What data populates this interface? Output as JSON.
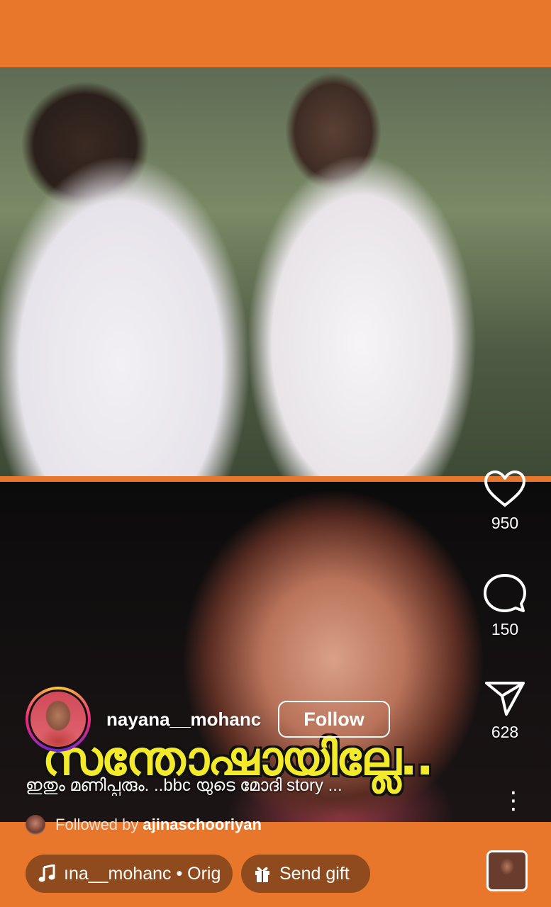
{
  "actions": {
    "likes": "950",
    "comments": "150",
    "shares": "628"
  },
  "author": {
    "username": "nayana__mohanc",
    "follow_label": "Follow"
  },
  "video": {
    "overlay_caption": "സന്തോഷായില്ലേ.."
  },
  "post": {
    "caption": "ഇതും മണിപ്പൂരും. ..bbc യുടെ മോദി story ..."
  },
  "followed_by": {
    "prefix": "Followed by",
    "name": "ajinaschooriyan"
  },
  "audio": {
    "label": "ına__mohanc • Orig"
  },
  "gift": {
    "label": "Send gift"
  },
  "colors": {
    "accent_orange": "#e8772b",
    "caption_yellow": "#f2ea2a"
  },
  "icons": [
    "heart-icon",
    "comment-icon",
    "share-icon",
    "more-icon",
    "music-note-icon",
    "gift-icon"
  ]
}
